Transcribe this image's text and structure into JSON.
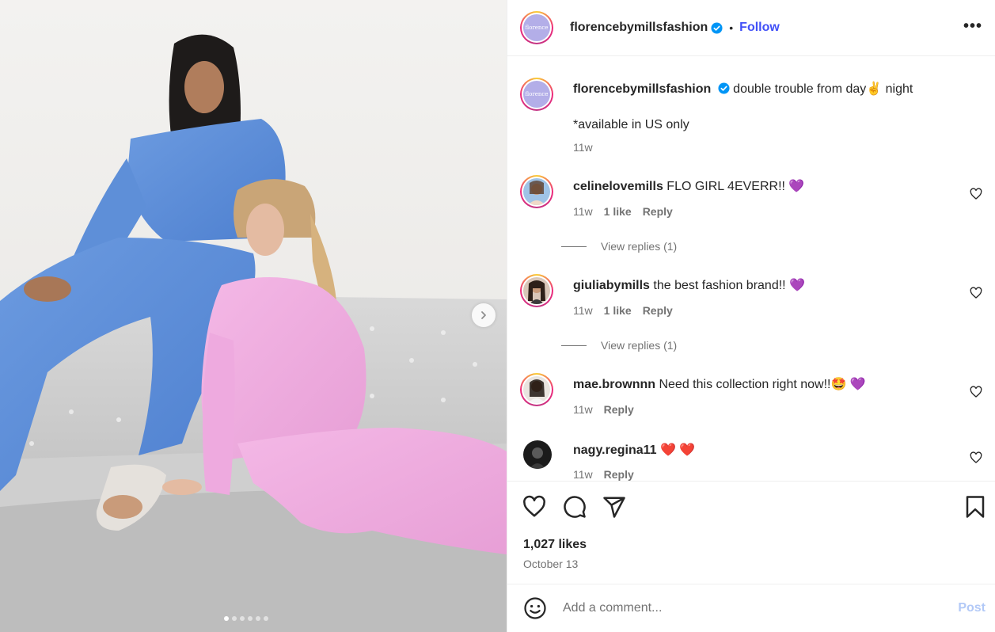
{
  "post": {
    "author": "florencebymillsfashion",
    "follow_label": "Follow",
    "separator": "•",
    "more_label": "•••",
    "avatar_text": "florence",
    "caption": {
      "text": "double trouble from day✌️ night",
      "line2": "*available in US only",
      "time": "11w"
    }
  },
  "comments": [
    {
      "user": "celinelovemills",
      "text": "FLO GIRL 4EVERR!! 💜",
      "time": "11w",
      "likes": "1 like",
      "reply": "Reply",
      "view_replies": "View replies (1)"
    },
    {
      "user": "giuliabymills",
      "text": "the best fashion brand!! 💜",
      "time": "11w",
      "likes": "1 like",
      "reply": "Reply",
      "view_replies": "View replies (1)"
    },
    {
      "user": "mae.brownnn",
      "text": "Need this collection right now!!🤩 💜",
      "time": "11w",
      "reply": "Reply"
    },
    {
      "user": "nagy.regina11",
      "text": "❤️ ❤️",
      "time": "11w",
      "reply": "Reply"
    }
  ],
  "footer": {
    "likes": "1,027 likes",
    "date": "October 13",
    "comment_placeholder": "Add a comment...",
    "post_label": "Post"
  },
  "carousel": {
    "total": 6,
    "current": 1
  },
  "colors": {
    "follow": "#4150f7",
    "verified": "#0095f6",
    "post_disabled": "#b2c9f7",
    "muted": "#737373"
  },
  "icons": [
    "verified-icon",
    "more-icon",
    "heart-icon",
    "comment-icon",
    "share-icon",
    "bookmark-icon",
    "emoji-icon",
    "chevron-right-icon"
  ]
}
